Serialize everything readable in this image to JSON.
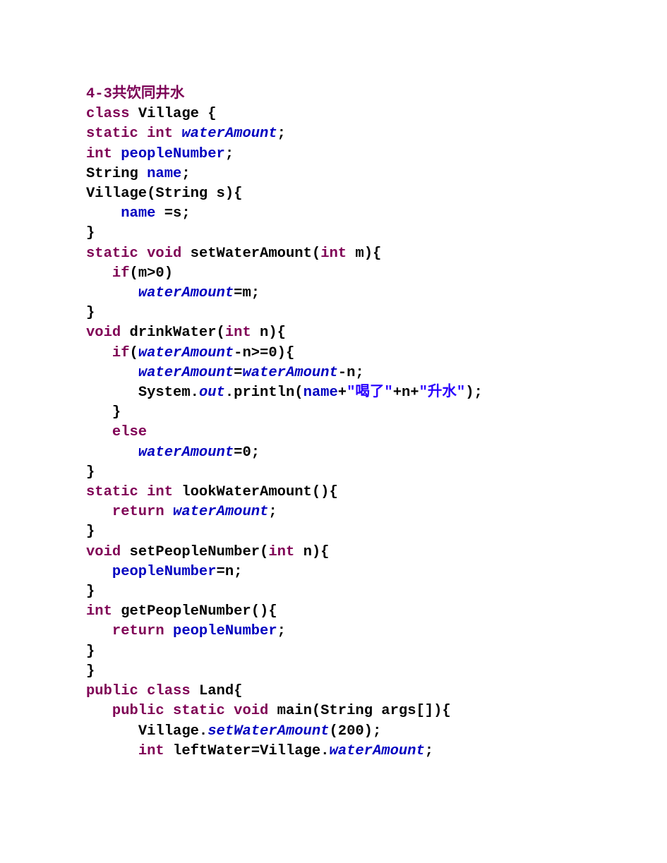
{
  "title": "4-3共饮同井水",
  "code": {
    "l1": {
      "k": "class",
      "t": " Village {"
    },
    "l2": {
      "k1": "static",
      "k2": "int",
      "f": "waterAmount",
      "t": ";"
    },
    "l3": {
      "k": "int",
      "f": "peopleNumber",
      "t": ";"
    },
    "l4": {
      "t1": "String ",
      "f": "name",
      "t2": ";"
    },
    "l5": {
      "t": "Village(String s){"
    },
    "l6": {
      "f": "name",
      "t": " =s;"
    },
    "l7": {
      "t": "}"
    },
    "l8": {
      "k1": "static",
      "k2": "void",
      "t1": " setWaterAmount(",
      "k3": "int",
      "t2": " m){"
    },
    "l9": {
      "k": "if",
      "t": "(m>0)"
    },
    "l10": {
      "f": "waterAmount",
      "t": "=m;"
    },
    "l11": {
      "t": "}"
    },
    "l12": {
      "k1": "void",
      "t1": " drinkWater(",
      "k2": "int",
      "t2": " n){"
    },
    "l13": {
      "k": "if",
      "t1": "(",
      "f": "waterAmount",
      "t2": "-n>=0){"
    },
    "l14": {
      "f1": "waterAmount",
      "t1": "=",
      "f2": "waterAmount",
      "t2": "-n;"
    },
    "l15": {
      "t1": "System.",
      "f1": "out",
      "t2": ".println(",
      "f2": "name",
      "t3": "+",
      "s1": "\"喝了\"",
      "t4": "+n+",
      "s2": "\"升水\"",
      "t5": ");"
    },
    "l16": {
      "t": "}"
    },
    "l17": {
      "k": "else"
    },
    "l18": {
      "f": "waterAmount",
      "t": "=0;"
    },
    "l19": {
      "t": "}"
    },
    "l20": {
      "k1": "static",
      "k2": "int",
      "t": " lookWaterAmount(){"
    },
    "l21": {
      "k": "return",
      "f": "waterAmount",
      "t": ";"
    },
    "l22": {
      "t": "}"
    },
    "l23": {
      "k1": "void",
      "t1": " setPeopleNumber(",
      "k2": "int",
      "t2": " n){"
    },
    "l24": {
      "f": "peopleNumber",
      "t": "=n;"
    },
    "l25": {
      "t": "}"
    },
    "l26": {
      "k": "int",
      "t": " getPeopleNumber(){"
    },
    "l27": {
      "k": "return",
      "f": "peopleNumber",
      "t": ";"
    },
    "l28": {
      "t": "}"
    },
    "l29": {
      "t": "}"
    },
    "l30": {
      "k1": "public",
      "k2": "class",
      "t": " Land{"
    },
    "l31": {
      "k1": "public",
      "k2": "static",
      "k3": "void",
      "t": " main(String args[]){"
    },
    "l32": {
      "t1": "Village.",
      "m": "setWaterAmount",
      "t2": "(200);"
    },
    "l33": {
      "k": "int",
      "t1": " leftWater=Village.",
      "f": "waterAmount",
      "t2": ";"
    }
  }
}
